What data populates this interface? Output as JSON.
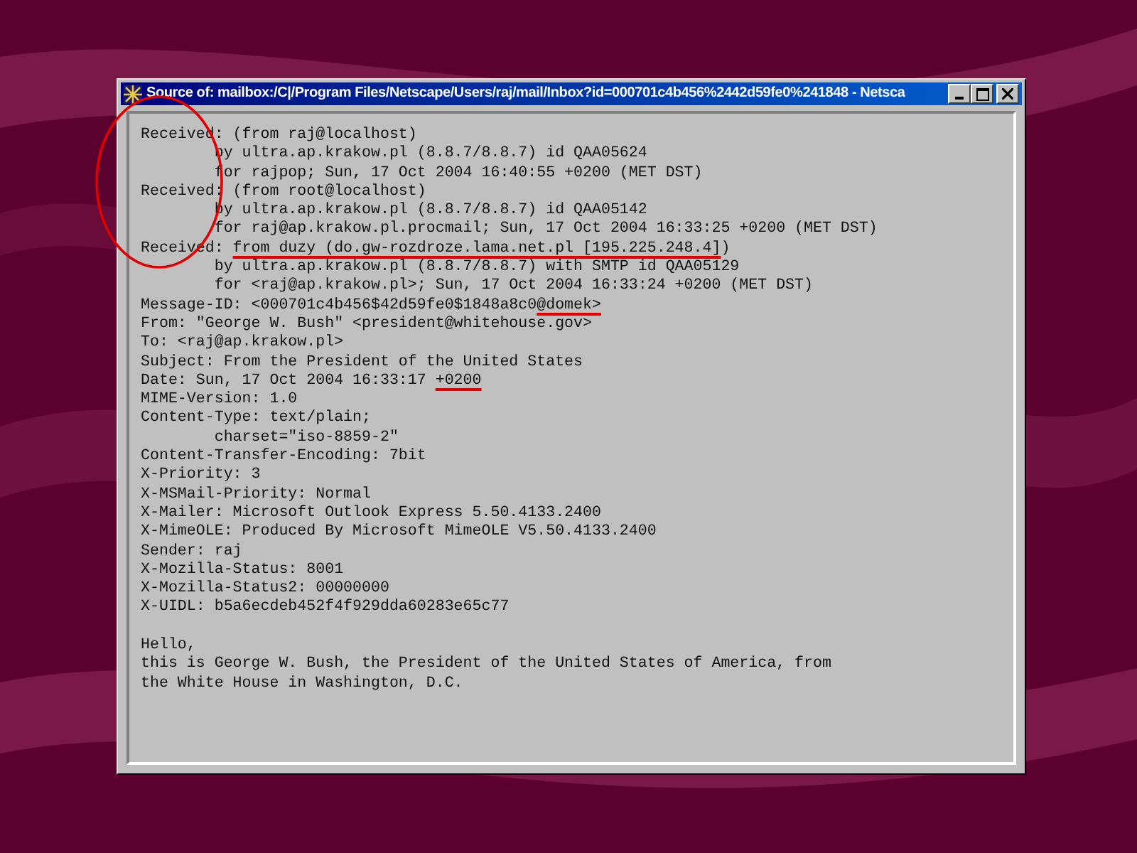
{
  "window": {
    "title": "Source of: mailbox:/C|/Program Files/Netscape/Users/raj/mail/Inbox?id=000701c4b456%2442d59fe0%241848 - Netsca",
    "buttons": [
      {
        "kind": "minimize"
      },
      {
        "kind": "maximize"
      },
      {
        "kind": "close"
      }
    ]
  },
  "source_lines": [
    {
      "kind": "text",
      "segments": [
        {
          "text": "Received: (from raj@localhost)",
          "underlined": false
        }
      ]
    },
    {
      "kind": "text",
      "segments": [
        {
          "text": "        by ultra.ap.krakow.pl (8.8.7/8.8.7) id QAA05624",
          "underlined": false
        }
      ]
    },
    {
      "kind": "text",
      "segments": [
        {
          "text": "        for rajpop; Sun, 17 Oct 2004 16:40:55 +0200 (MET DST)",
          "underlined": false
        }
      ]
    },
    {
      "kind": "text",
      "segments": [
        {
          "text": "Received: (from root@localhost)",
          "underlined": false
        }
      ]
    },
    {
      "kind": "text",
      "segments": [
        {
          "text": "        by ultra.ap.krakow.pl (8.8.7/8.8.7) id QAA05142",
          "underlined": false
        }
      ]
    },
    {
      "kind": "text",
      "segments": [
        {
          "text": "        for raj@ap.krakow.pl.procmail; Sun, 17 Oct 2004 16:33:25 +0200 (MET DST)",
          "underlined": false
        }
      ]
    },
    {
      "kind": "text",
      "segments": [
        {
          "text": "Received: ",
          "underlined": false
        },
        {
          "text": "from duzy (do.gw-rozdroze.lama.net.pl [195.225.248.4]",
          "underlined": true
        },
        {
          "text": ")",
          "underlined": false
        }
      ]
    },
    {
      "kind": "text",
      "segments": [
        {
          "text": "        by ultra.ap.krakow.pl (8.8.7/8.8.7) with SMTP id QAA05129",
          "underlined": false
        }
      ]
    },
    {
      "kind": "text",
      "segments": [
        {
          "text": "        for <raj@ap.krakow.pl>; Sun, 17 Oct 2004 16:33:24 +0200 (MET DST)",
          "underlined": false
        }
      ]
    },
    {
      "kind": "text",
      "segments": [
        {
          "text": "Message-ID: <000701c4b456$42d59fe0$1848a8c0",
          "underlined": false
        },
        {
          "text": "@domek>",
          "underlined": true
        }
      ]
    },
    {
      "kind": "text",
      "segments": [
        {
          "text": "From: \"George W. Bush\" <president@whitehouse.gov>",
          "underlined": false
        }
      ]
    },
    {
      "kind": "text",
      "segments": [
        {
          "text": "To: <raj@ap.krakow.pl>",
          "underlined": false
        }
      ]
    },
    {
      "kind": "text",
      "segments": [
        {
          "text": "Subject: From the President of the United States",
          "underlined": false
        }
      ]
    },
    {
      "kind": "text",
      "segments": [
        {
          "text": "Date: Sun, 17 Oct 2004 16:33:17 ",
          "underlined": false
        },
        {
          "text": "+0200",
          "underlined": true
        }
      ]
    },
    {
      "kind": "text",
      "segments": [
        {
          "text": "MIME-Version: 1.0",
          "underlined": false
        }
      ]
    },
    {
      "kind": "text",
      "segments": [
        {
          "text": "Content-Type: text/plain;",
          "underlined": false
        }
      ]
    },
    {
      "kind": "text",
      "segments": [
        {
          "text": "        charset=\"iso-8859-2\"",
          "underlined": false
        }
      ]
    },
    {
      "kind": "text",
      "segments": [
        {
          "text": "Content-Transfer-Encoding: 7bit",
          "underlined": false
        }
      ]
    },
    {
      "kind": "text",
      "segments": [
        {
          "text": "X-Priority: 3",
          "underlined": false
        }
      ]
    },
    {
      "kind": "text",
      "segments": [
        {
          "text": "X-MSMail-Priority: Normal",
          "underlined": false
        }
      ]
    },
    {
      "kind": "text",
      "segments": [
        {
          "text": "X-Mailer: Microsoft Outlook Express 5.50.4133.2400",
          "underlined": false
        }
      ]
    },
    {
      "kind": "text",
      "segments": [
        {
          "text": "X-MimeOLE: Produced By Microsoft MimeOLE V5.50.4133.2400",
          "underlined": false
        }
      ]
    },
    {
      "kind": "text",
      "segments": [
        {
          "text": "Sender: raj",
          "underlined": false
        }
      ]
    },
    {
      "kind": "text",
      "segments": [
        {
          "text": "X-Mozilla-Status: 8001",
          "underlined": false
        }
      ]
    },
    {
      "kind": "text",
      "segments": [
        {
          "text": "X-Mozilla-Status2: 00000000",
          "underlined": false
        }
      ]
    },
    {
      "kind": "text",
      "segments": [
        {
          "text": "X-UIDL: b5a6ecdeb452f4f929dda60283e65c77",
          "underlined": false
        }
      ]
    },
    {
      "kind": "blank"
    },
    {
      "kind": "text",
      "segments": [
        {
          "text": "Hello,",
          "underlined": false
        }
      ]
    },
    {
      "kind": "text",
      "segments": [
        {
          "text": "this is George W. Bush, the President of the United States of America, from",
          "underlined": false
        }
      ]
    },
    {
      "kind": "text",
      "segments": [
        {
          "text": "the White House in Washington, D.C.",
          "underlined": false
        }
      ]
    }
  ]
}
